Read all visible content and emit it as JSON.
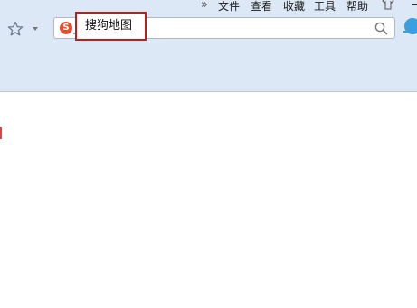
{
  "menubar": {
    "overflow_glyph": "»",
    "items": [
      "文件",
      "查看",
      "收藏",
      "工具",
      "帮助"
    ]
  },
  "addressbar": {
    "logo_letter": "S",
    "value": "搜狗地图"
  },
  "colors": {
    "chrome_bg": "#dde8f6",
    "highlight_border": "#c31a1a",
    "logo_red": "#e94b2d",
    "accent_blue": "#3aa0e0"
  },
  "icons": [
    "star-icon",
    "dropdown-caret-icon",
    "sogou-logo-icon",
    "search-icon",
    "skin-shirt-icon",
    "minimize-icon"
  ]
}
